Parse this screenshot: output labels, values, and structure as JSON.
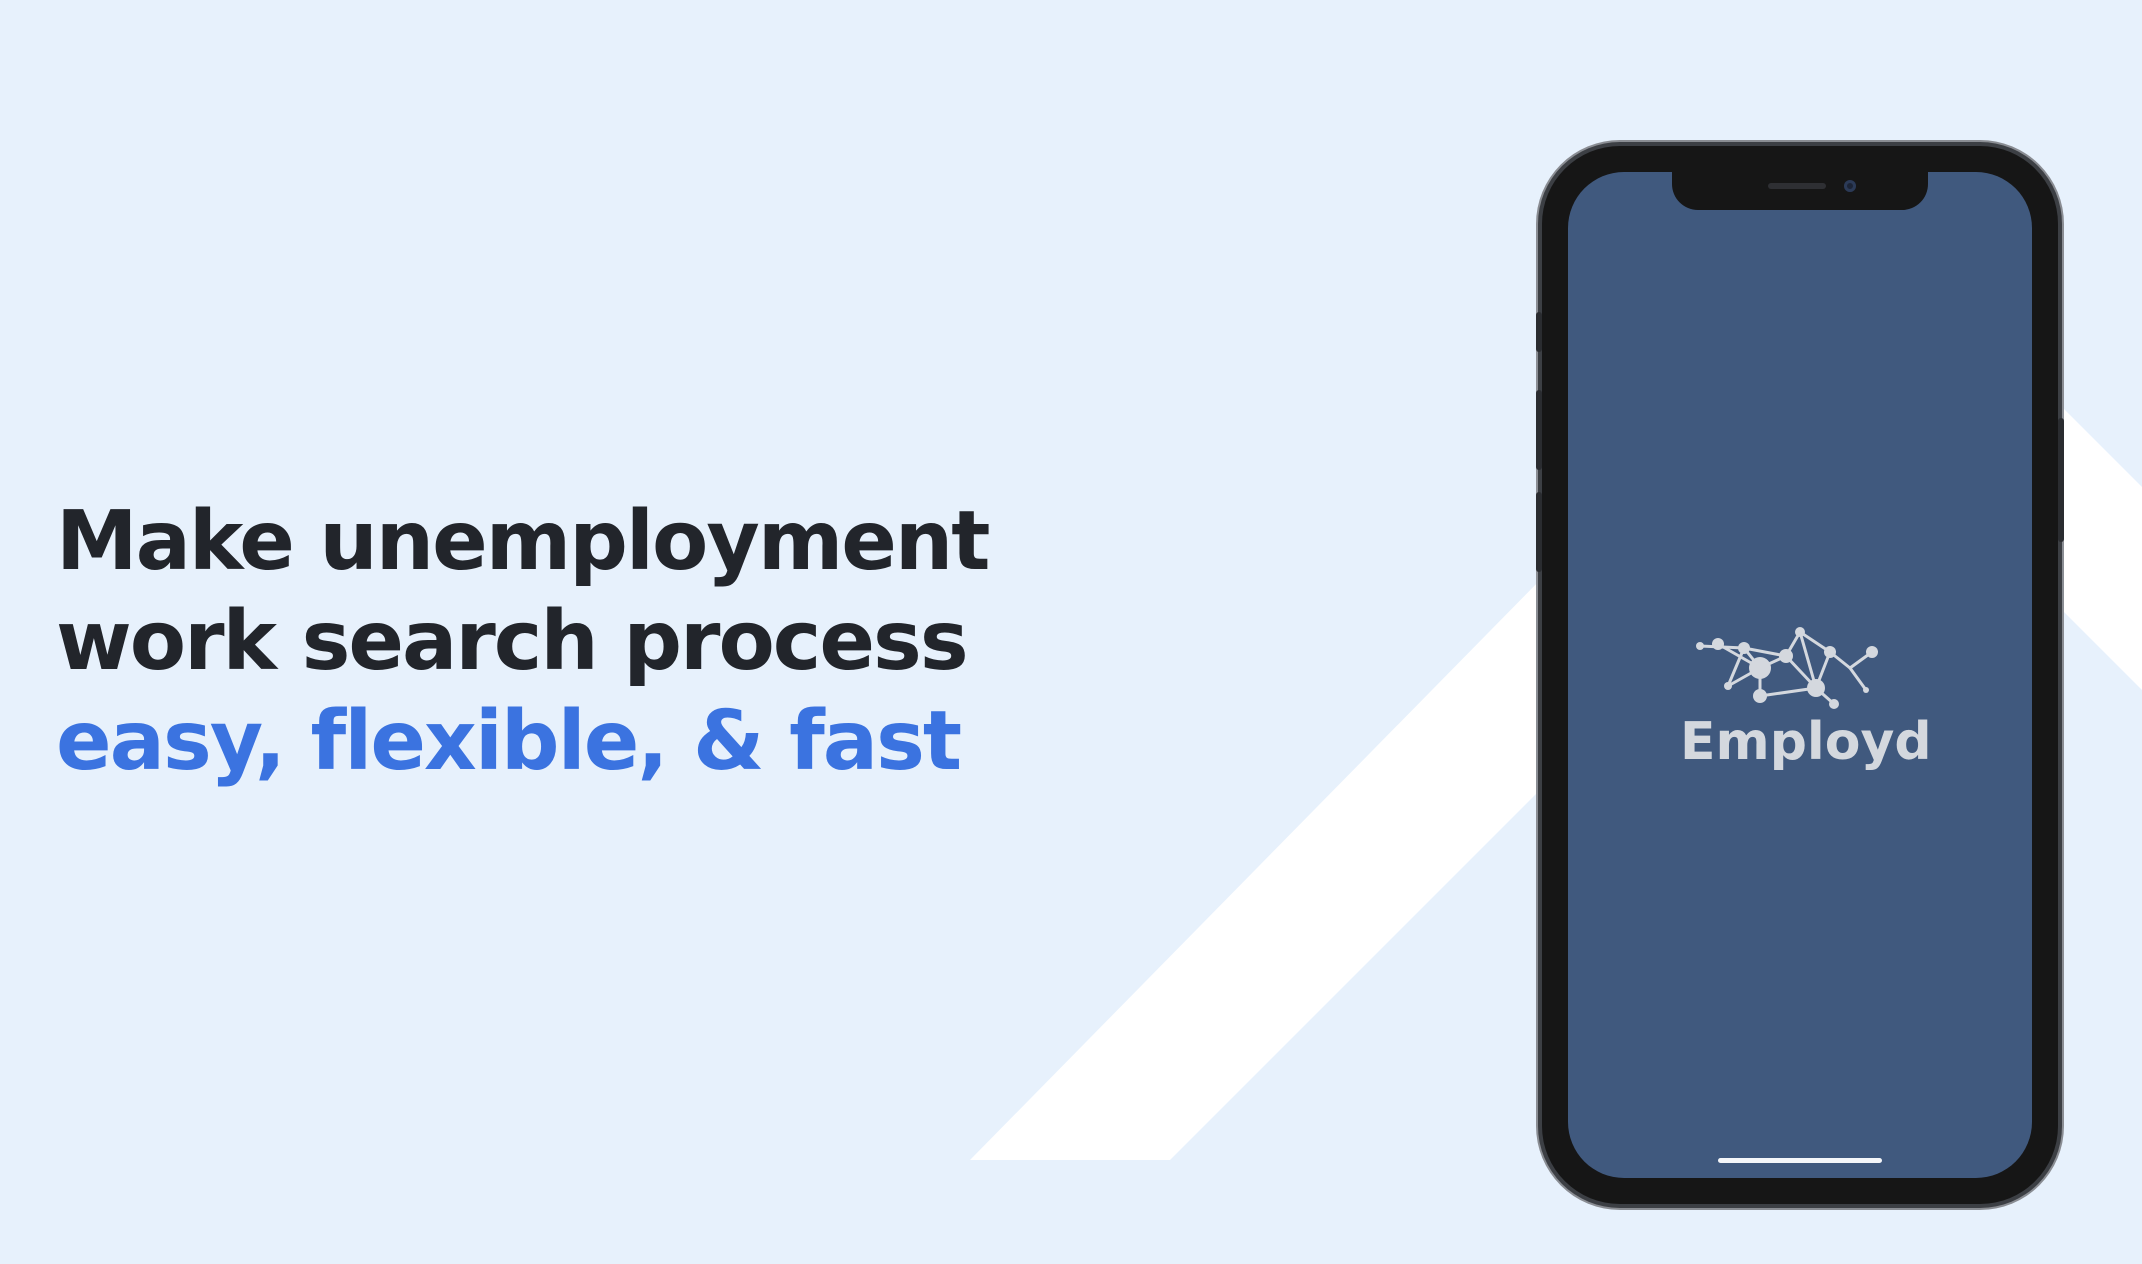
{
  "hero": {
    "line1": "Make unemployment",
    "line2": "work search process",
    "line3_accent": "easy, flexible, & fast"
  },
  "phone": {
    "brand_name": "Employd"
  },
  "colors": {
    "background": "#e7f1fc",
    "headline": "#22252b",
    "accent": "#3b73e0",
    "screen": "#40597e",
    "logo": "#d4d8de"
  }
}
